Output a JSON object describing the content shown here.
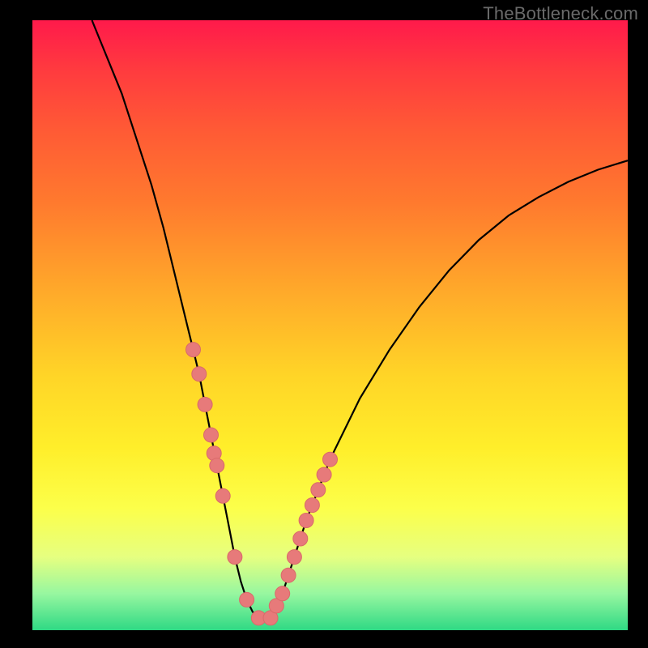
{
  "watermark": "TheBottleneck.com",
  "colors": {
    "curve_stroke": "#000000",
    "marker_fill": "#e77a7a",
    "marker_stroke": "#d96a6a",
    "gradient_top": "#ff1a4b",
    "gradient_bottom": "#2fd984"
  },
  "chart_data": {
    "type": "line",
    "title": "",
    "xlabel": "",
    "ylabel": "",
    "xlim": [
      0,
      100
    ],
    "ylim": [
      0,
      100
    ],
    "series": [
      {
        "name": "bottleneck-curve",
        "x": [
          10,
          15,
          20,
          22,
          24,
          26,
          27,
          28,
          29,
          30,
          31,
          32,
          33,
          34,
          35,
          36,
          37,
          38,
          39,
          40,
          42,
          44,
          46,
          50,
          55,
          60,
          65,
          70,
          75,
          80,
          85,
          90,
          95,
          100
        ],
        "y": [
          100,
          88,
          73,
          66,
          58,
          50,
          46,
          42,
          37,
          32,
          27,
          22,
          17,
          12,
          8,
          5,
          3,
          2,
          1.5,
          2,
          6,
          12,
          18,
          28,
          38,
          46,
          53,
          59,
          64,
          68,
          71,
          73.5,
          75.5,
          77
        ]
      }
    ],
    "markers": {
      "name": "highlight-points",
      "x": [
        27,
        28,
        29,
        30,
        30.5,
        31,
        32,
        34,
        36,
        38,
        40,
        41,
        42,
        43,
        44,
        45,
        46,
        47,
        48,
        49,
        50
      ],
      "y": [
        46,
        42,
        37,
        32,
        29,
        27,
        22,
        12,
        5,
        2,
        2,
        4,
        6,
        9,
        12,
        15,
        18,
        20.5,
        23,
        25.5,
        28
      ]
    }
  }
}
